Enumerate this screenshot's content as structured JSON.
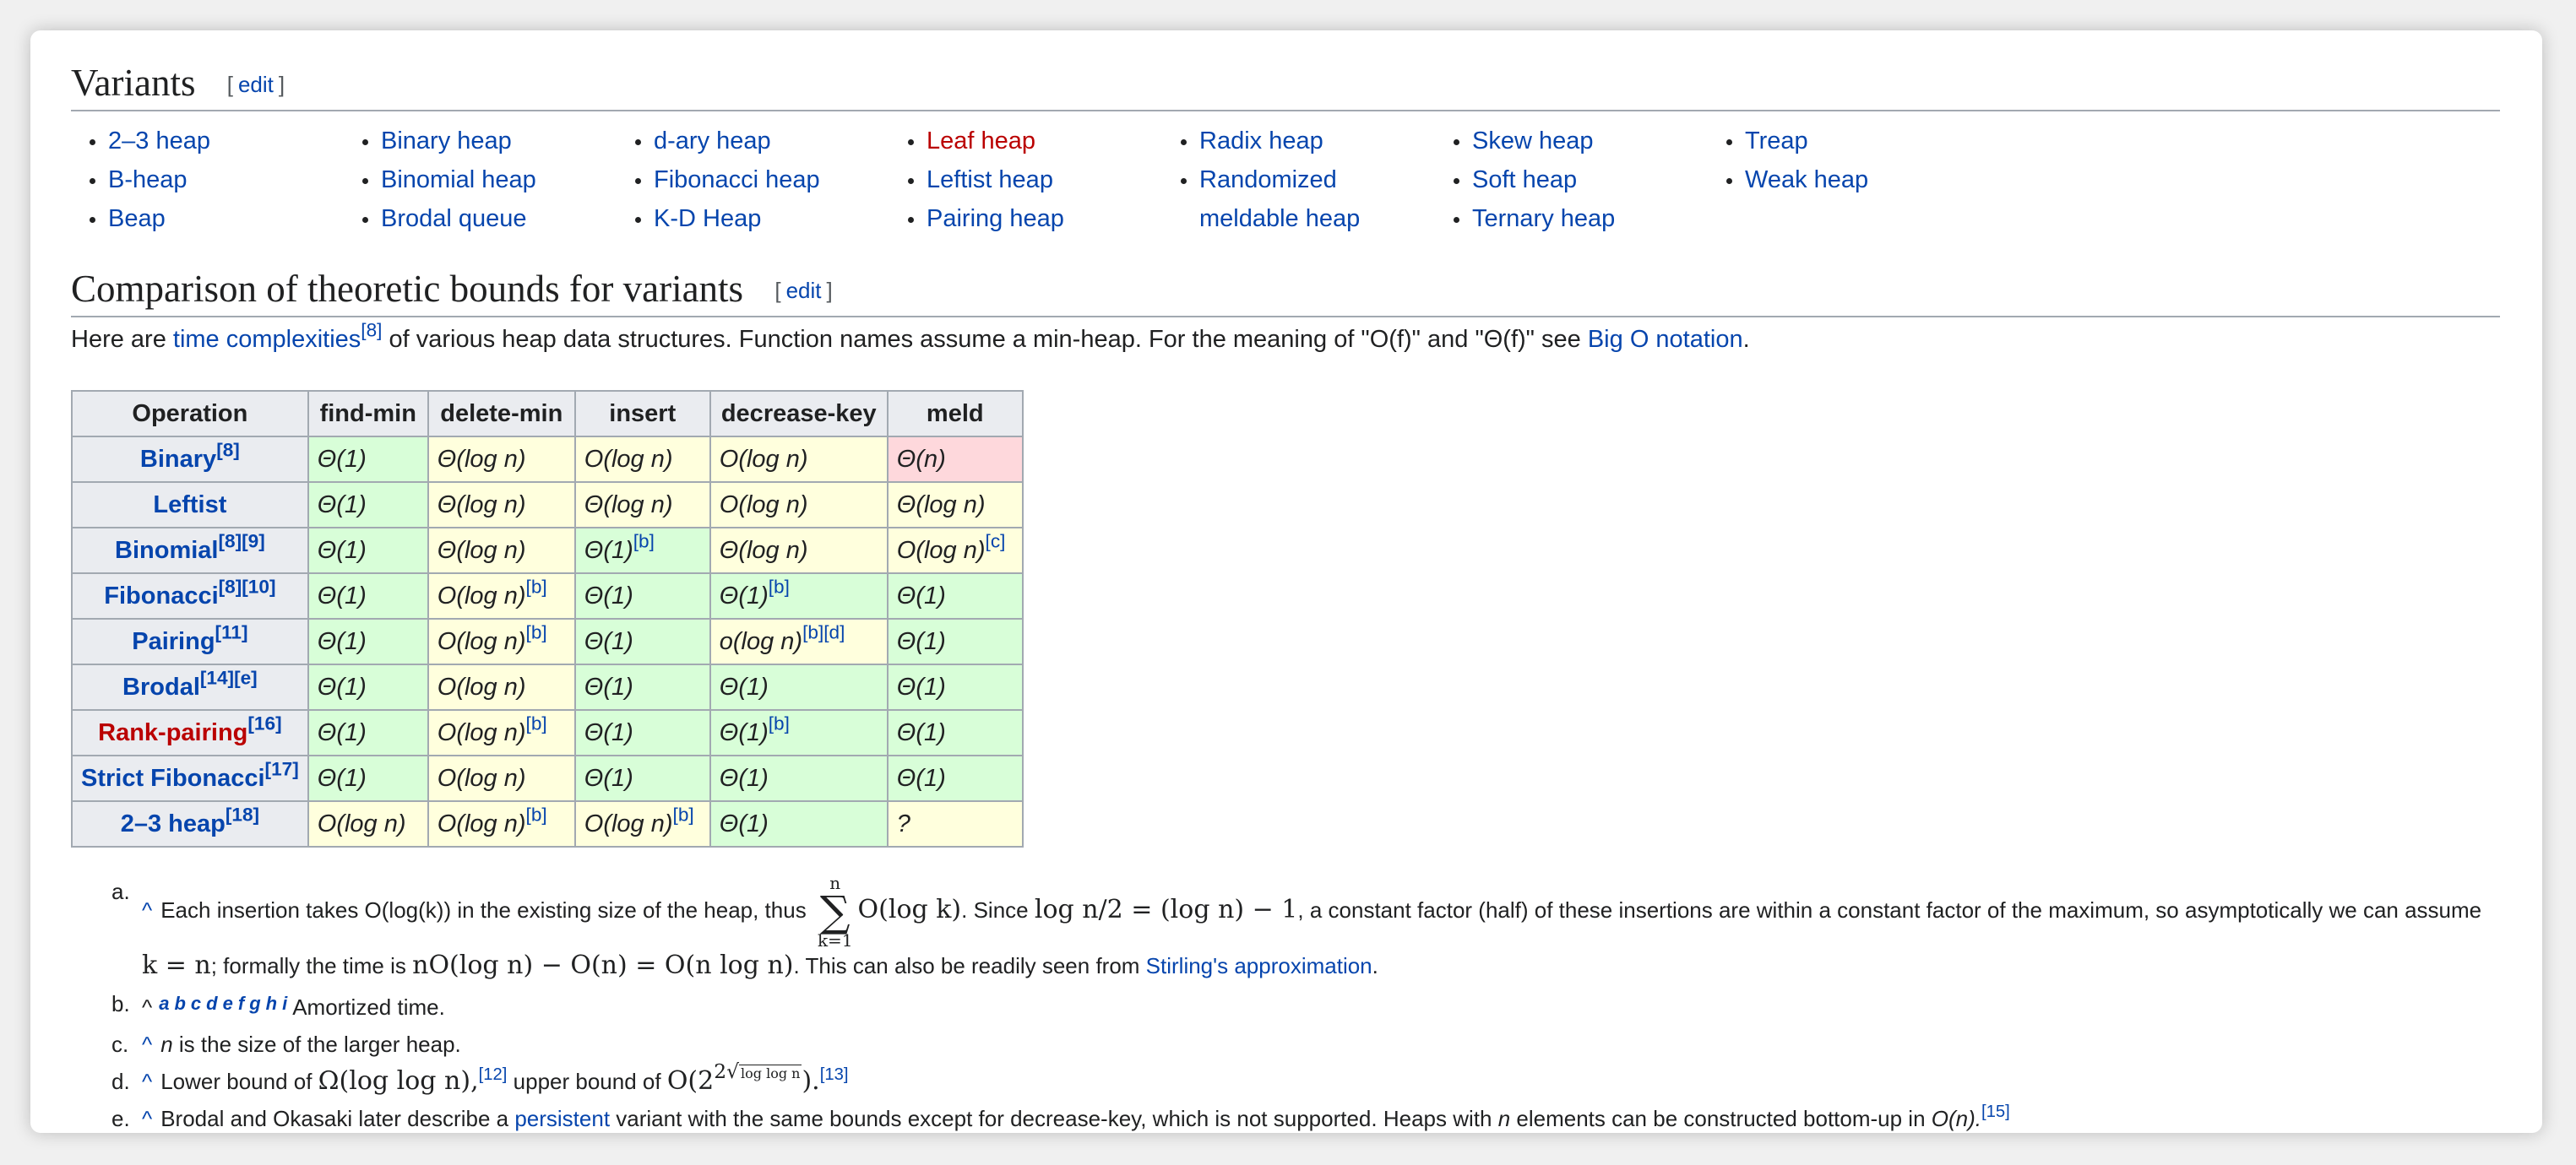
{
  "variants": {
    "title": "Variants",
    "edit_label": "edit",
    "columns": [
      [
        {
          "text": "2–3 heap",
          "red": false
        },
        {
          "text": "B-heap",
          "red": false
        },
        {
          "text": "Beap",
          "red": false
        }
      ],
      [
        {
          "text": "Binary heap",
          "red": false
        },
        {
          "text": "Binomial heap",
          "red": false
        },
        {
          "text": "Brodal queue",
          "red": false
        }
      ],
      [
        {
          "text": "d-ary heap",
          "red": false
        },
        {
          "text": "Fibonacci heap",
          "red": false
        },
        {
          "text": "K-D Heap",
          "red": false
        }
      ],
      [
        {
          "text": "Leaf heap",
          "red": true
        },
        {
          "text": "Leftist heap",
          "red": false
        },
        {
          "text": "Pairing heap",
          "red": false
        }
      ],
      [
        {
          "text": "Radix heap",
          "red": false
        },
        {
          "text": "Randomized meldable heap",
          "red": false
        }
      ],
      [
        {
          "text": "Skew heap",
          "red": false
        },
        {
          "text": "Soft heap",
          "red": false
        },
        {
          "text": "Ternary heap",
          "red": false
        }
      ],
      [
        {
          "text": "Treap",
          "red": false
        },
        {
          "text": "Weak heap",
          "red": false
        }
      ]
    ]
  },
  "comparison": {
    "title": "Comparison of theoretic bounds for variants",
    "edit_label": "edit",
    "intro": {
      "pre": "Here are ",
      "link": "time complexities",
      "ref": "[8]",
      "mid": " of various heap data structures. Function names assume a min-heap. For the meaning of \"O(f)\" and \"Θ(f)\" see ",
      "link2": "Big O notation",
      "post": "."
    },
    "headers": [
      "Operation",
      "find-min",
      "delete-min",
      "insert",
      "decrease-key",
      "meld"
    ],
    "rows": [
      {
        "op": "Binary",
        "ref": "[8]",
        "red": false,
        "cells": [
          {
            "t": "Θ(1)",
            "c": "g",
            "s": ""
          },
          {
            "t": "Θ(log n)",
            "c": "y",
            "s": ""
          },
          {
            "t": "O(log n)",
            "c": "y",
            "s": ""
          },
          {
            "t": "O(log n)",
            "c": "y",
            "s": ""
          },
          {
            "t": "Θ(n)",
            "c": "r",
            "s": ""
          }
        ]
      },
      {
        "op": "Leftist",
        "ref": "",
        "red": false,
        "cells": [
          {
            "t": "Θ(1)",
            "c": "g",
            "s": ""
          },
          {
            "t": "Θ(log n)",
            "c": "y",
            "s": ""
          },
          {
            "t": "Θ(log n)",
            "c": "y",
            "s": ""
          },
          {
            "t": "O(log n)",
            "c": "y",
            "s": ""
          },
          {
            "t": "Θ(log n)",
            "c": "y",
            "s": ""
          }
        ]
      },
      {
        "op": "Binomial",
        "ref": "[8][9]",
        "red": false,
        "cells": [
          {
            "t": "Θ(1)",
            "c": "g",
            "s": ""
          },
          {
            "t": "Θ(log n)",
            "c": "y",
            "s": ""
          },
          {
            "t": "Θ(1)",
            "c": "g",
            "s": "[b]"
          },
          {
            "t": "Θ(log n)",
            "c": "y",
            "s": ""
          },
          {
            "t": "O(log n)",
            "c": "y",
            "s": "[c]"
          }
        ]
      },
      {
        "op": "Fibonacci",
        "ref": "[8][10]",
        "red": false,
        "cells": [
          {
            "t": "Θ(1)",
            "c": "g",
            "s": ""
          },
          {
            "t": "O(log n)",
            "c": "y",
            "s": "[b]"
          },
          {
            "t": "Θ(1)",
            "c": "g",
            "s": ""
          },
          {
            "t": "Θ(1)",
            "c": "g",
            "s": "[b]"
          },
          {
            "t": "Θ(1)",
            "c": "g",
            "s": ""
          }
        ]
      },
      {
        "op": "Pairing",
        "ref": "[11]",
        "red": false,
        "cells": [
          {
            "t": "Θ(1)",
            "c": "g",
            "s": ""
          },
          {
            "t": "O(log n)",
            "c": "y",
            "s": "[b]"
          },
          {
            "t": "Θ(1)",
            "c": "g",
            "s": ""
          },
          {
            "t": "o(log n)",
            "c": "y",
            "s": "[b][d]"
          },
          {
            "t": "Θ(1)",
            "c": "g",
            "s": ""
          }
        ]
      },
      {
        "op": "Brodal",
        "ref": "[14][e]",
        "red": false,
        "cells": [
          {
            "t": "Θ(1)",
            "c": "g",
            "s": ""
          },
          {
            "t": "O(log n)",
            "c": "y",
            "s": ""
          },
          {
            "t": "Θ(1)",
            "c": "g",
            "s": ""
          },
          {
            "t": "Θ(1)",
            "c": "g",
            "s": ""
          },
          {
            "t": "Θ(1)",
            "c": "g",
            "s": ""
          }
        ]
      },
      {
        "op": "Rank-pairing",
        "ref": "[16]",
        "red": true,
        "cells": [
          {
            "t": "Θ(1)",
            "c": "g",
            "s": ""
          },
          {
            "t": "O(log n)",
            "c": "y",
            "s": "[b]"
          },
          {
            "t": "Θ(1)",
            "c": "g",
            "s": ""
          },
          {
            "t": "Θ(1)",
            "c": "g",
            "s": "[b]"
          },
          {
            "t": "Θ(1)",
            "c": "g",
            "s": ""
          }
        ]
      },
      {
        "op": "Strict Fibonacci",
        "ref": "[17]",
        "red": false,
        "cells": [
          {
            "t": "Θ(1)",
            "c": "g",
            "s": ""
          },
          {
            "t": "O(log n)",
            "c": "y",
            "s": ""
          },
          {
            "t": "Θ(1)",
            "c": "g",
            "s": ""
          },
          {
            "t": "Θ(1)",
            "c": "g",
            "s": ""
          },
          {
            "t": "Θ(1)",
            "c": "g",
            "s": ""
          }
        ]
      },
      {
        "op": "2–3 heap",
        "ref": "[18]",
        "red": false,
        "cells": [
          {
            "t": "O(log n)",
            "c": "y",
            "s": ""
          },
          {
            "t": "O(log n)",
            "c": "y",
            "s": "[b]"
          },
          {
            "t": "O(log n)",
            "c": "y",
            "s": "[b]"
          },
          {
            "t": "Θ(1)",
            "c": "g",
            "s": ""
          },
          {
            "t": "?",
            "c": "y",
            "s": ""
          }
        ]
      }
    ]
  },
  "notes": {
    "caret": "^",
    "a": {
      "label": "a.",
      "p1": "Each insertion takes O(log(k)) in the existing size of the heap, thus ",
      "sum_top": "n",
      "sum_sig": "∑",
      "sum_bot": "k=1",
      "m1": "O(log k)",
      "p2": ". Since ",
      "m2": "log n/2 = (log n) − 1",
      "p3": ", a constant factor (half) of these insertions are within a constant factor of the maximum, so asymptotically we can assume ",
      "m3": "k = n",
      "p4": "; formally the time is ",
      "m4": "nO(log n) − O(n) = O(n log n)",
      "p5": ". This can also be readily seen from ",
      "link": "Stirling's approximation",
      "p6": "."
    },
    "b": {
      "label": "b.",
      "letters": [
        "a",
        "b",
        "c",
        "d",
        "e",
        "f",
        "g",
        "h",
        "i"
      ],
      "text": "Amortized time."
    },
    "c": {
      "label": "c.",
      "var": "n",
      "text": " is the size of the larger heap."
    },
    "d": {
      "label": "d.",
      "p1": "Lower bound of ",
      "m1": "Ω(log log n),",
      "r1": "[12]",
      "p2": " upper bound of ",
      "m2a": "O(2",
      "m2b": "2",
      "m2c": "log log n",
      "m2d": ").",
      "r2": "[13]"
    },
    "e": {
      "label": "e.",
      "p1": "Brodal and Okasaki later describe a ",
      "link": "persistent",
      "p2": " variant with the same bounds except for decrease-key, which is not supported. Heaps with ",
      "var": "n",
      "p3": " elements can be constructed bottom-up in ",
      "m": "O(n).",
      "ref": "[15]"
    }
  }
}
